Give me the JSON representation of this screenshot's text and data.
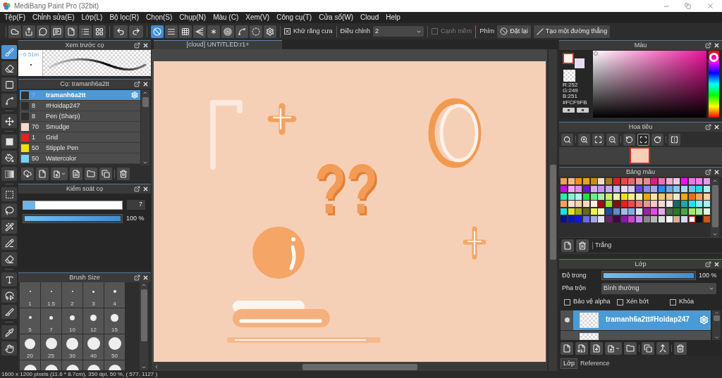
{
  "window": {
    "title": "MediBang Paint Pro (32bit)"
  },
  "menu": [
    "Tệp(F)",
    "Chỉnh sửa(E)",
    "Lớp(L)",
    "Bộ lọc(R)",
    "Chọn(S)",
    "Chụp(N)",
    "Màu (C)",
    "Xem(V)",
    "Công cụ(T)",
    "Cửa sổ(W)",
    "Cloud",
    "Help"
  ],
  "toolbar": {
    "snap_buttons": [
      {
        "selected": true
      },
      {
        "selected": false
      },
      {
        "selected": false
      },
      {
        "selected": false
      },
      {
        "selected": false
      },
      {
        "selected": false
      },
      {
        "selected": false
      },
      {
        "selected": false
      }
    ],
    "antialias": {
      "label": "Khử răng cưa",
      "checked": true
    },
    "correction": {
      "label": "Điều chỉnh",
      "value": "2"
    },
    "soft_edge": {
      "label": "Cạnh mềm",
      "checked": false,
      "disabled": true
    },
    "keys_label": "Phím",
    "buttons": [
      "Đặt lại",
      "Tạo một đường thẳng"
    ]
  },
  "tools": [
    {
      "selected": true
    },
    {
      "selected": false
    },
    {
      "selected": false
    },
    {
      "selected": false
    },
    {
      "selected": false
    },
    {
      "selected": false
    },
    {
      "selected": false
    },
    {
      "selected": false
    },
    {
      "selected": false
    },
    {
      "selected": false
    },
    {
      "selected": false
    },
    {
      "selected": false
    },
    {
      "selected": false
    },
    {
      "selected": false
    },
    {
      "selected": false
    },
    {
      "selected": false
    },
    {
      "selected": false
    },
    {
      "selected": false
    }
  ],
  "brush_preview": {
    "title": "Xem trước cọ",
    "size": "0.51m"
  },
  "brush_list": {
    "title": "Cọ: tramanh6a2tt",
    "items": [
      {
        "color": "#2e2e2e",
        "size": "7",
        "name": "tramanh6a2tt",
        "selected": true
      },
      {
        "color": "#2e2e2e",
        "size": "8",
        "name": "#Hoidap247",
        "selected": false
      },
      {
        "color": "#2e2e2e",
        "size": "8",
        "name": "Pen (Sharp)",
        "selected": false
      },
      {
        "color": "#f8dcc6",
        "size": "70",
        "name": "Smudge",
        "selected": false
      },
      {
        "color": "#e42222",
        "size": "1",
        "name": "Grid",
        "selected": false
      },
      {
        "color": "#f0e010",
        "size": "50",
        "name": "Stipple Pen",
        "selected": false
      },
      {
        "color": "#72d4f4",
        "size": "50",
        "name": "Watercolor",
        "selected": false
      }
    ]
  },
  "brush_control": {
    "title": "Kiểm soát cọ",
    "size": {
      "level": 0.12,
      "reading": "7"
    },
    "opacity": {
      "level": 1,
      "reading": "100 %"
    }
  },
  "brush_size": {
    "title": "Brush Size",
    "sizes": [
      "1",
      "1.5",
      "2",
      "3",
      "4",
      "5",
      "7",
      "10",
      "12",
      "15",
      "20",
      "25",
      "30",
      "40",
      "50"
    ]
  },
  "document": {
    "tab": "[cloud] UNTITLED:r1+",
    "artwork_text": "??"
  },
  "color": {
    "title": "Màu",
    "foreground": {
      "color": "#fcf9fb"
    },
    "background": {
      "color": "#e8dcf4"
    },
    "values": [
      "R:252",
      "G:249",
      "B:251"
    ],
    "hex": "#FCF9FB"
  },
  "navigator": {
    "title": "Hoa tiêu",
    "buttons": [
      {
        "selected": false
      },
      {
        "selected": false
      },
      {
        "selected": false
      },
      {
        "selected": false
      },
      {
        "selected": false
      },
      {
        "selected": true
      },
      {
        "selected": false
      },
      {
        "selected": false
      }
    ]
  },
  "palette": {
    "title": "Bảng màu",
    "swatches": [
      {
        "color": "#f0a050",
        "selected": false
      },
      {
        "color": "#f2b888",
        "selected": false
      },
      {
        "color": "#f09020",
        "selected": false
      },
      {
        "color": "#f0a020",
        "selected": false
      },
      {
        "color": "#d08818",
        "selected": false
      },
      {
        "color": "#f2dcd0",
        "selected": false
      },
      {
        "color": "#b07818",
        "selected": false
      },
      {
        "color": "#e02020",
        "selected": false
      },
      {
        "color": "#e84848",
        "selected": false
      },
      {
        "color": "#e86868",
        "selected": false
      },
      {
        "color": "#f09898",
        "selected": false
      },
      {
        "color": "#f08888",
        "selected": false
      },
      {
        "color": "#e01888",
        "selected": false
      },
      {
        "color": "#f070b0",
        "selected": false
      },
      {
        "color": "#f4b0d0",
        "selected": false
      },
      {
        "color": "#f4c8e0",
        "selected": false
      },
      {
        "color": "#f010f0",
        "selected": false
      },
      {
        "color": "#e878e8",
        "selected": false
      },
      {
        "color": "#f080f0",
        "selected": false
      },
      {
        "color": "#e898e8",
        "selected": false
      },
      {
        "color": "#c010e8",
        "selected": false
      },
      {
        "color": "#f4a8f4",
        "selected": false
      },
      {
        "color": "#e090f0",
        "selected": false
      },
      {
        "color": "#7010e0",
        "selected": false
      },
      {
        "color": "#d8a8f4",
        "selected": false
      },
      {
        "color": "#c890f0",
        "selected": false
      },
      {
        "color": "#c8a8f4",
        "selected": false
      },
      {
        "color": "#c8b8f4",
        "selected": false
      },
      {
        "color": "#e8d8f4",
        "selected": false
      },
      {
        "color": "#d8c8f4",
        "selected": false
      },
      {
        "color": "#6848e8",
        "selected": false
      },
      {
        "color": "#8888f0",
        "selected": false
      },
      {
        "color": "#a8a8f4",
        "selected": false
      },
      {
        "color": "#2090f0",
        "selected": false
      },
      {
        "color": "#68a8f0",
        "selected": false
      },
      {
        "color": "#88c8f4",
        "selected": false
      },
      {
        "color": "#a8d8f4",
        "selected": false
      },
      {
        "color": "#68c8f0",
        "selected": false
      },
      {
        "color": "#20e0e0",
        "selected": false
      },
      {
        "color": "#a8f0f0",
        "selected": false
      },
      {
        "color": "#20f0a8",
        "selected": false
      },
      {
        "color": "#88f0d8",
        "selected": false
      },
      {
        "color": "#b8f4f0",
        "selected": false
      },
      {
        "color": "#20e040",
        "selected": false
      },
      {
        "color": "#68f088",
        "selected": false
      },
      {
        "color": "#a8f0a8",
        "selected": false
      },
      {
        "color": "#c8f068",
        "selected": false
      },
      {
        "color": "#e8f4a8",
        "selected": false
      },
      {
        "color": "#f0e018",
        "selected": false
      },
      {
        "color": "#f4f088",
        "selected": false
      },
      {
        "color": "#f4f0b8",
        "selected": false
      },
      {
        "color": "#f0a808",
        "selected": false
      },
      {
        "color": "#f4e8a8",
        "selected": false
      },
      {
        "color": "#f4c868",
        "selected": false
      },
      {
        "color": "#f4c888",
        "selected": false
      },
      {
        "color": "#f4e8c8",
        "selected": false
      },
      {
        "color": "#f4a808",
        "selected": false
      },
      {
        "color": "#f07010",
        "selected": false
      },
      {
        "color": "#f4a868",
        "selected": false
      },
      {
        "color": "#f8d0a0",
        "selected": false
      },
      {
        "color": "#f4a060",
        "selected": false
      },
      {
        "color": "#f8e0d0",
        "selected": false
      },
      {
        "color": "#f4d0b0",
        "selected": false
      },
      {
        "color": "#f4d8c0",
        "selected": false
      },
      {
        "color": "#f8f0e0",
        "selected": false
      },
      {
        "color": "#a01010",
        "selected": false
      },
      {
        "color": "#a0e020",
        "selected": false
      },
      {
        "color": "#801010",
        "selected": false
      },
      {
        "color": "#e82020",
        "selected": false
      },
      {
        "color": "#f04848",
        "selected": false
      },
      {
        "color": "#f07878",
        "selected": false
      },
      {
        "color": "#e89898",
        "selected": false
      },
      {
        "color": "#f4c8c8",
        "selected": false
      },
      {
        "color": "#f4d8d8",
        "selected": false
      },
      {
        "color": "#f4e8e8",
        "selected": false
      },
      {
        "color": "#186868",
        "selected": false
      },
      {
        "color": "#20a8a8",
        "selected": false
      },
      {
        "color": "#20e0f0",
        "selected": false
      },
      {
        "color": "#88f0f0",
        "selected": false
      },
      {
        "color": "#a8f0f0",
        "selected": false
      },
      {
        "color": "#20e0e0",
        "selected": false
      },
      {
        "color": "#e0e020",
        "selected": false
      },
      {
        "color": "#a8a820",
        "selected": false
      },
      {
        "color": "#686820",
        "selected": false
      },
      {
        "color": "#f0f048",
        "selected": false
      },
      {
        "color": "#f4f4c8",
        "selected": false
      },
      {
        "color": "#2048a8",
        "selected": false
      },
      {
        "color": "#6888c8",
        "selected": false
      },
      {
        "color": "#a8b8d8",
        "selected": false
      },
      {
        "color": "#88a8e8",
        "selected": false
      },
      {
        "color": "#e0e0f4",
        "selected": false
      },
      {
        "color": "#a020a8",
        "selected": false
      },
      {
        "color": "#e848e8",
        "selected": false
      },
      {
        "color": "#e8a8e8",
        "selected": false
      },
      {
        "color": "#486848",
        "selected": false
      },
      {
        "color": "#208020",
        "selected": false
      },
      {
        "color": "#48a848",
        "selected": false
      },
      {
        "color": "#a8e868",
        "selected": false
      },
      {
        "color": "#a8e8a8",
        "selected": false
      },
      {
        "color": "#e0f4e0",
        "selected": false
      },
      {
        "color": "#101088",
        "selected": false
      },
      {
        "color": "#1010c8",
        "selected": false
      },
      {
        "color": "#1010f0",
        "selected": false
      },
      {
        "color": "#6868f0",
        "selected": false
      },
      {
        "color": "#a8a8e8",
        "selected": false
      },
      {
        "color": "#e0e0f4",
        "selected": false
      },
      {
        "color": "#682068",
        "selected": false
      },
      {
        "color": "#480048",
        "selected": false
      },
      {
        "color": "#8818a8",
        "selected": false
      },
      {
        "color": "#c848c8",
        "selected": false
      },
      {
        "color": "#c888e8",
        "selected": false
      },
      {
        "color": "#888888",
        "selected": false
      },
      {
        "color": "#b8b8b8",
        "selected": false
      },
      {
        "color": "#e0e0e0",
        "selected": false
      },
      {
        "color": "#f8f8f8",
        "selected": false
      },
      {
        "color": "#d8b098",
        "selected": false
      },
      {
        "color": "#d8d8f4",
        "selected": false
      },
      {
        "color": "#ffffff",
        "selected": true
      },
      {
        "color": "#101010",
        "selected": false
      },
      {
        "color": "#c85818",
        "selected": false
      }
    ],
    "color_name": "Trắng"
  },
  "layers": {
    "title": "Lớp",
    "opacity": {
      "label": "Độ trong",
      "level": 1,
      "reading": "100 %"
    },
    "blend": {
      "label": "Pha trộn",
      "value": "Bình thường"
    },
    "options": [
      {
        "label": "Bảo vệ alpha",
        "checked": false
      },
      {
        "label": "Xén bớt",
        "checked": false
      },
      {
        "label": "Khóa",
        "checked": false
      }
    ],
    "items": [
      {
        "name": "tramanh6a2tt#Hoidap247",
        "selected": true
      },
      {
        "selected": false
      }
    ]
  },
  "panel_tabs": [
    {
      "label": "Lớp",
      "selected": true
    },
    {
      "label": "Reference",
      "selected": false
    }
  ],
  "status_bar": "1600 x 1200 pixels (11.6 * 8.7cm), 350 dpi, 50 %, ( 577, 1127 )"
}
